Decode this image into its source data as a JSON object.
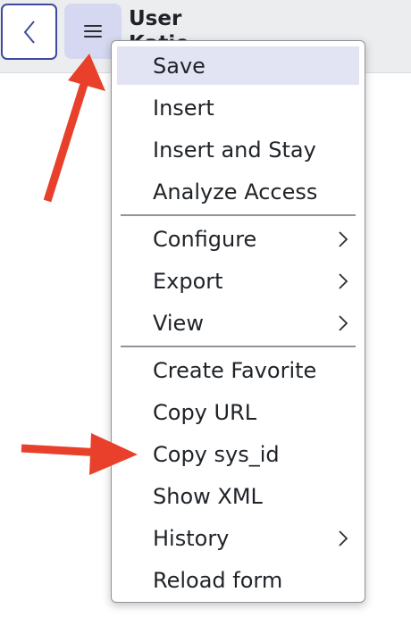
{
  "header": {
    "title": "User",
    "subtitle": "Katie Jarrett"
  },
  "menu": {
    "group1": [
      "Save",
      "Insert",
      "Insert and Stay",
      "Analyze Access"
    ],
    "group2": [
      "Configure",
      "Export",
      "View"
    ],
    "group3": [
      "Create Favorite",
      "Copy URL",
      "Copy sys_id",
      "Show XML",
      "History",
      "Reload form"
    ]
  },
  "colors": {
    "accent": "#3f4a9e",
    "highlight": "#e3e4f3",
    "annotation_arrow": "#e8402a"
  },
  "icons": {
    "back": "chevron-left-icon",
    "menu": "hamburger-icon",
    "submenu": "chevron-right-icon"
  }
}
